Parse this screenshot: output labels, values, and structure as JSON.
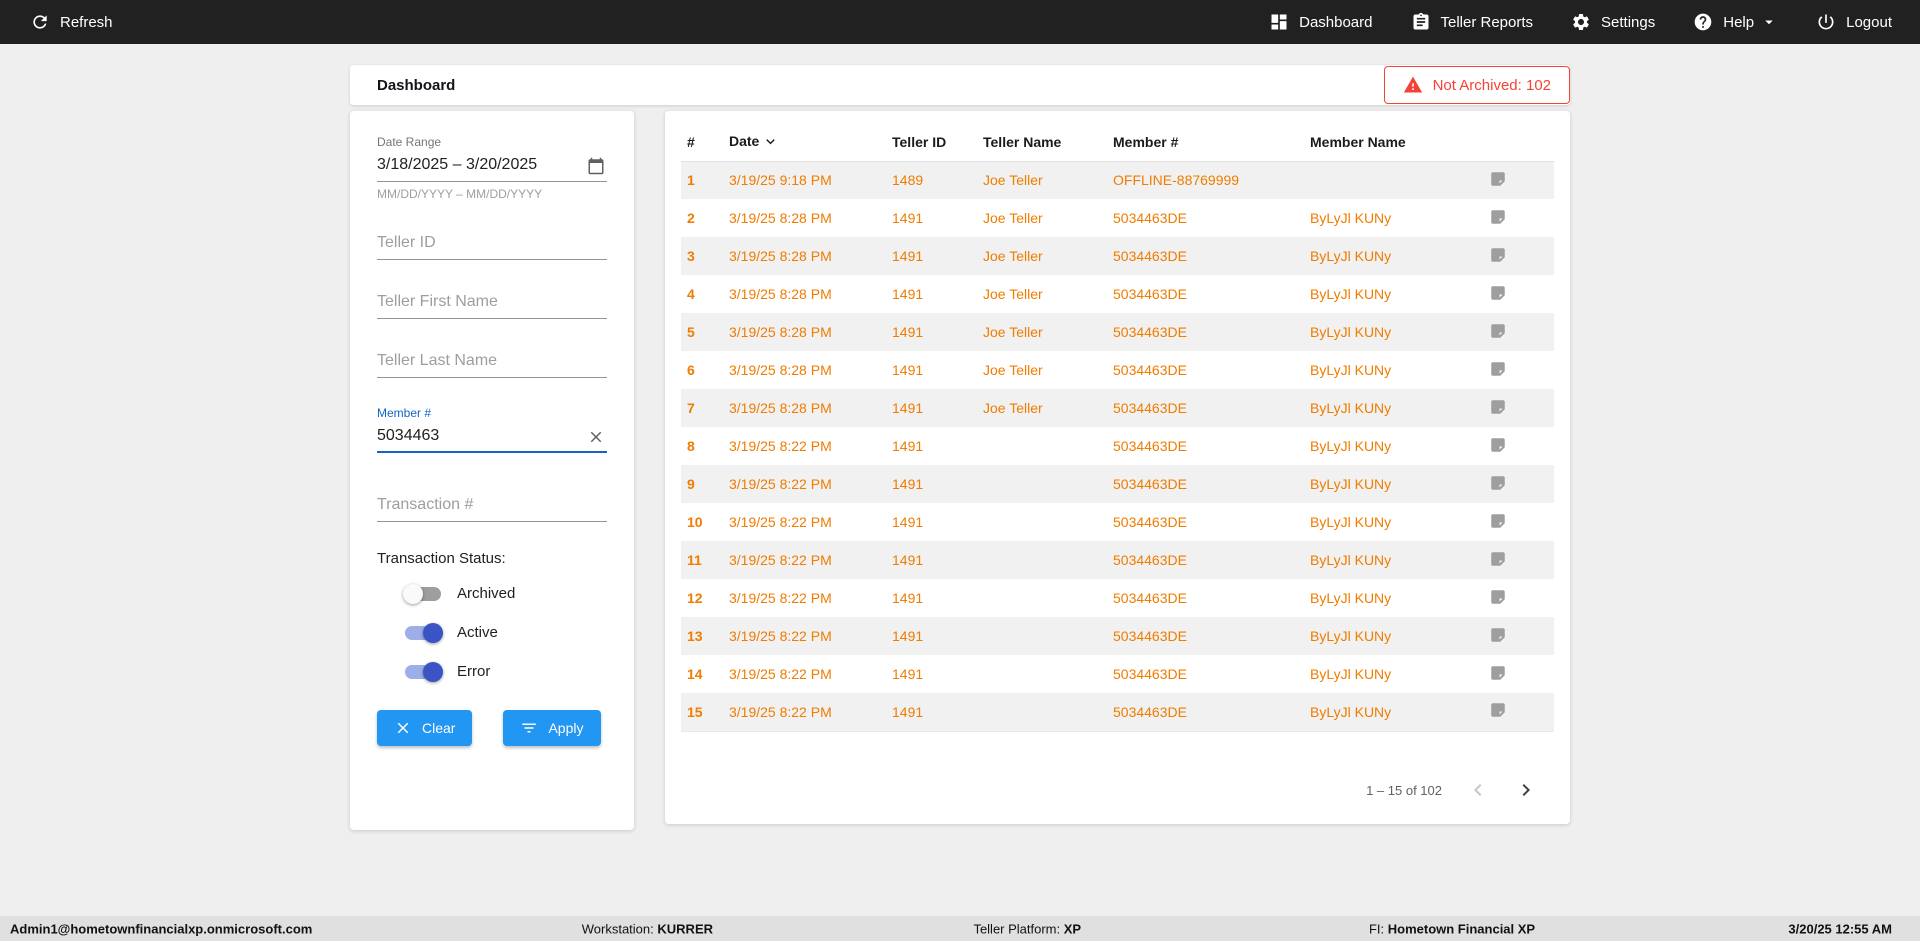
{
  "topbar": {
    "refresh": "Refresh",
    "items": [
      {
        "label": "Dashboard",
        "icon": "dashboard-icon"
      },
      {
        "label": "Teller Reports",
        "icon": "reports-icon"
      },
      {
        "label": "Settings",
        "icon": "settings-icon"
      },
      {
        "label": "Help",
        "icon": "help-icon",
        "caret": "chevron-down-icon"
      },
      {
        "label": "Logout",
        "icon": "logout-icon"
      }
    ]
  },
  "header": {
    "title": "Dashboard",
    "badge": {
      "label": "Not Archived: 102",
      "icon": "warning-icon"
    }
  },
  "filters": {
    "date_range": {
      "label": "Date Range",
      "value": "3/18/2025 – 3/20/2025",
      "helper": "MM/DD/YYYY – MM/DD/YYYY",
      "icon": "calendar-icon"
    },
    "teller_id": {
      "placeholder": "Teller ID",
      "value": ""
    },
    "teller_first_name": {
      "placeholder": "Teller First Name",
      "value": ""
    },
    "teller_last_name": {
      "placeholder": "Teller Last Name",
      "value": ""
    },
    "member_number": {
      "label": "Member #",
      "value": "5034463",
      "clear_icon": "close-icon"
    },
    "transaction_number": {
      "placeholder": "Transaction #",
      "value": ""
    },
    "status": {
      "label": "Transaction Status:",
      "toggles": [
        {
          "label": "Archived",
          "on": false
        },
        {
          "label": "Active",
          "on": true
        },
        {
          "label": "Error",
          "on": true
        }
      ]
    },
    "buttons": {
      "clear": "Clear",
      "apply": "Apply"
    }
  },
  "table": {
    "columns": [
      "#",
      "Date",
      "Teller ID",
      "Teller Name",
      "Member #",
      "Member Name"
    ],
    "sorted_column": "Date",
    "sort_direction": "desc",
    "rows": [
      {
        "num": "1",
        "date": "3/19/25 9:18 PM",
        "teller_id": "1489",
        "teller_name": "Joe Teller",
        "member_number": "OFFLINE-88769999",
        "member_name": ""
      },
      {
        "num": "2",
        "date": "3/19/25 8:28 PM",
        "teller_id": "1491",
        "teller_name": "Joe Teller",
        "member_number": "5034463DE",
        "member_name": "ByLyJl KUNy"
      },
      {
        "num": "3",
        "date": "3/19/25 8:28 PM",
        "teller_id": "1491",
        "teller_name": "Joe Teller",
        "member_number": "5034463DE",
        "member_name": "ByLyJl KUNy"
      },
      {
        "num": "4",
        "date": "3/19/25 8:28 PM",
        "teller_id": "1491",
        "teller_name": "Joe Teller",
        "member_number": "5034463DE",
        "member_name": "ByLyJl KUNy"
      },
      {
        "num": "5",
        "date": "3/19/25 8:28 PM",
        "teller_id": "1491",
        "teller_name": "Joe Teller",
        "member_number": "5034463DE",
        "member_name": "ByLyJl KUNy"
      },
      {
        "num": "6",
        "date": "3/19/25 8:28 PM",
        "teller_id": "1491",
        "teller_name": "Joe Teller",
        "member_number": "5034463DE",
        "member_name": "ByLyJl KUNy"
      },
      {
        "num": "7",
        "date": "3/19/25 8:28 PM",
        "teller_id": "1491",
        "teller_name": "Joe Teller",
        "member_number": "5034463DE",
        "member_name": "ByLyJl KUNy"
      },
      {
        "num": "8",
        "date": "3/19/25 8:22 PM",
        "teller_id": "1491",
        "teller_name": "",
        "member_number": "5034463DE",
        "member_name": "ByLyJl KUNy"
      },
      {
        "num": "9",
        "date": "3/19/25 8:22 PM",
        "teller_id": "1491",
        "teller_name": "",
        "member_number": "5034463DE",
        "member_name": "ByLyJl KUNy"
      },
      {
        "num": "10",
        "date": "3/19/25 8:22 PM",
        "teller_id": "1491",
        "teller_name": "",
        "member_number": "5034463DE",
        "member_name": "ByLyJl KUNy"
      },
      {
        "num": "11",
        "date": "3/19/25 8:22 PM",
        "teller_id": "1491",
        "teller_name": "",
        "member_number": "5034463DE",
        "member_name": "ByLyJl KUNy"
      },
      {
        "num": "12",
        "date": "3/19/25 8:22 PM",
        "teller_id": "1491",
        "teller_name": "",
        "member_number": "5034463DE",
        "member_name": "ByLyJl KUNy"
      },
      {
        "num": "13",
        "date": "3/19/25 8:22 PM",
        "teller_id": "1491",
        "teller_name": "",
        "member_number": "5034463DE",
        "member_name": "ByLyJl KUNy"
      },
      {
        "num": "14",
        "date": "3/19/25 8:22 PM",
        "teller_id": "1491",
        "teller_name": "",
        "member_number": "5034463DE",
        "member_name": "ByLyJl KUNy"
      },
      {
        "num": "15",
        "date": "3/19/25 8:22 PM",
        "teller_id": "1491",
        "teller_name": "",
        "member_number": "5034463DE",
        "member_name": "ByLyJl KUNy"
      }
    ],
    "row_icon": "note-icon",
    "pagination": {
      "range": "1 – 15 of 102",
      "prev_enabled": false,
      "next_enabled": true
    }
  },
  "statusbar": {
    "user": "Admin1@hometownfinancialxp.onmicrosoft.com",
    "workstation_label": "Workstation:",
    "workstation": "KURRER",
    "platform_label": "Teller Platform:",
    "platform": "XP",
    "fi_label": "FI:",
    "fi": "Hometown Financial XP",
    "datetime": "3/20/25 12:55 AM"
  },
  "colors": {
    "topbar-bg": "#212121",
    "page-bg": "#efefef",
    "statusbar-bg": "#e0e0e0",
    "accent-orange": "#f07c00",
    "accent-blue": "#2196f3",
    "toggle-blue": "#3a53c5",
    "toggle-track": "#9daee8",
    "focus-blue": "#1565c0",
    "error-red": "#f44336"
  }
}
